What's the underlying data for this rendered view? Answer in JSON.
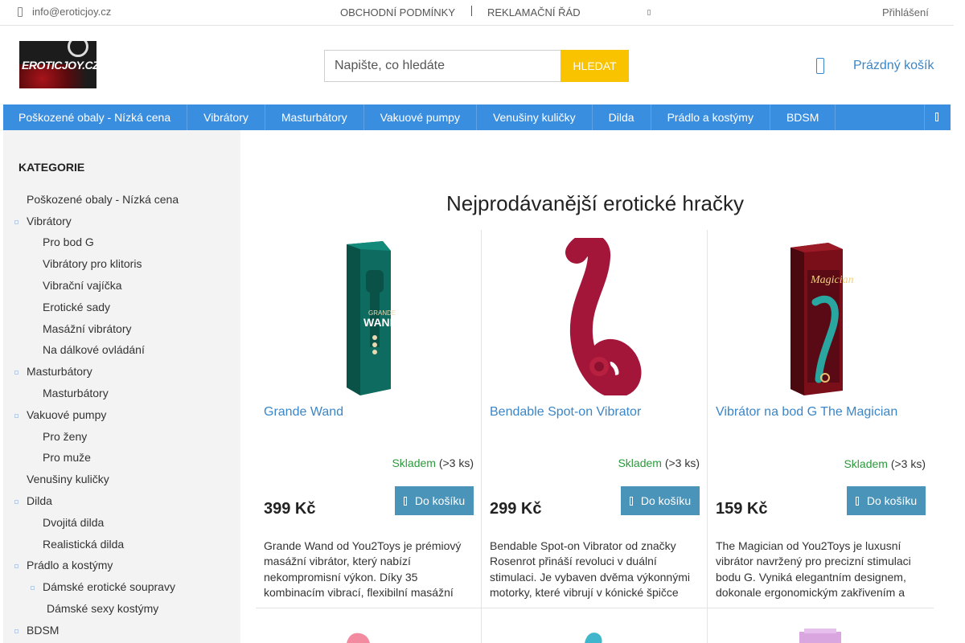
{
  "topbar": {
    "email": "info@eroticjoy.cz",
    "links": [
      "OBCHODNÍ PODMÍNKY",
      "REKLAMAČNÍ ŘÁD"
    ],
    "login": "Přihlášení"
  },
  "header": {
    "logo_text": "EROTICJOY.CZ",
    "search_placeholder": "Napište, co hledáte",
    "search_button": "HLEDAT",
    "cart_label": "Prázdný košík"
  },
  "nav": {
    "items": [
      "Poškozené obaly - Nízká cena",
      "Vibrátory",
      "Masturbátory",
      "Vakuové pumpy",
      "Venušiny kuličky",
      "Dilda",
      "Prádlo a kostýmy",
      "BDSM"
    ]
  },
  "sidebar": {
    "heading": "KATEGORIE",
    "items": [
      {
        "label": "Poškozené obaly - Nízká cena"
      },
      {
        "label": "Vibrátory"
      },
      {
        "label": "Pro bod G"
      },
      {
        "label": "Vibrátory pro klitoris"
      },
      {
        "label": "Vibrační vajíčka"
      },
      {
        "label": "Erotické sady"
      },
      {
        "label": "Masážní vibrátory"
      },
      {
        "label": "Na dálkové ovládání"
      },
      {
        "label": "Masturbátory"
      },
      {
        "label": "Masturbátory"
      },
      {
        "label": "Vakuové pumpy"
      },
      {
        "label": "Pro ženy"
      },
      {
        "label": "Pro muže"
      },
      {
        "label": "Venušiny kuličky"
      },
      {
        "label": "Dilda"
      },
      {
        "label": "Dvojitá dilda"
      },
      {
        "label": "Realistická dilda"
      },
      {
        "label": "Prádlo a kostýmy"
      },
      {
        "label": "Dámské erotické soupravy"
      },
      {
        "label": "Dámské sexy kostýmy"
      },
      {
        "label": "BDSM"
      }
    ]
  },
  "main": {
    "title": "Nejprodávanější erotické hračky",
    "products": [
      {
        "name": "Grande Wand",
        "stock": "Skladem",
        "stock_qty": "(>3 ks)",
        "price": "399 Kč",
        "button": "Do košíku",
        "description": "Grande Wand od You2Toys je prémiový masážní vibrátor, který nabízí nekompromisní výkon. Díky 35 kombinacím vibrací, flexibilní masážní",
        "color": "#0d6b5f"
      },
      {
        "name": "Bendable Spot-on Vibrator",
        "stock": "Skladem",
        "stock_qty": "(>3 ks)",
        "price": "299 Kč",
        "button": "Do košíku",
        "description": "Bendable Spot-on Vibrator od značky Rosenrot přináší revoluci v duální stimulaci. Je vybaven dvěma výkonnými motorky, které vibrují v kónické špičce pro",
        "color": "#a3163a"
      },
      {
        "name": "Vibrátor na bod G The Magician",
        "stock": "Skladem",
        "stock_qty": "(>3 ks)",
        "price": "159 Kč",
        "button": "Do košíku",
        "description": "The Magician od You2Toys je luxusní vibrátor navržený pro precizní stimulaci bodu G. Vyniká elegantním designem, dokonale ergonomickým zakřivením a",
        "color": "#2aa6a1"
      }
    ]
  }
}
